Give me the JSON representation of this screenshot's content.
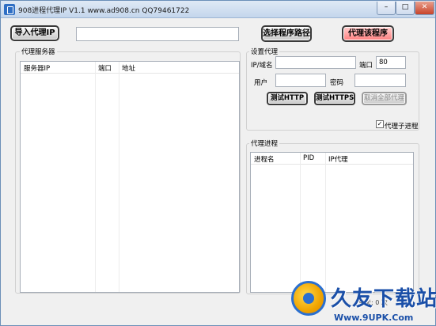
{
  "window": {
    "title": "908进程代理IP  V1.1   www.ad908.cn  QQ79461722",
    "min_label": "–",
    "max_label": "□",
    "close_label": "✕"
  },
  "toolbar": {
    "import_label": "导入代理IP",
    "path_value": "",
    "select_path_label": "选择程序路径",
    "proxy_program_label": "代理该程序"
  },
  "server_panel": {
    "group_label": "代理服务器",
    "columns": [
      "服务器IP",
      "端口",
      "地址"
    ],
    "rows": []
  },
  "settings": {
    "group_label": "设置代理",
    "ip_label": "IP/域名",
    "ip_value": "",
    "port_label": "端口",
    "port_value": "80",
    "user_label": "用户",
    "user_value": "",
    "password_label": "密码",
    "password_value": "",
    "test_http_label": "测试HTTP",
    "test_https_label": "测试HTTPS",
    "cancel_all_label": "取消全部代理",
    "child_process_label": "代理子进程",
    "child_process_checked": true
  },
  "process_panel": {
    "group_label": "代理进程",
    "columns": [
      "进程名",
      "PID",
      "IP代理"
    ],
    "rows": []
  },
  "status": {
    "text": "今天: 0 次"
  },
  "watermark": {
    "title": "久友下载站",
    "url": "Www.9UPK.Com"
  },
  "colors": {
    "accent_red_button": "#ff8f8f",
    "title_bar": "#c4d6ec",
    "close_button": "#c8432a"
  }
}
